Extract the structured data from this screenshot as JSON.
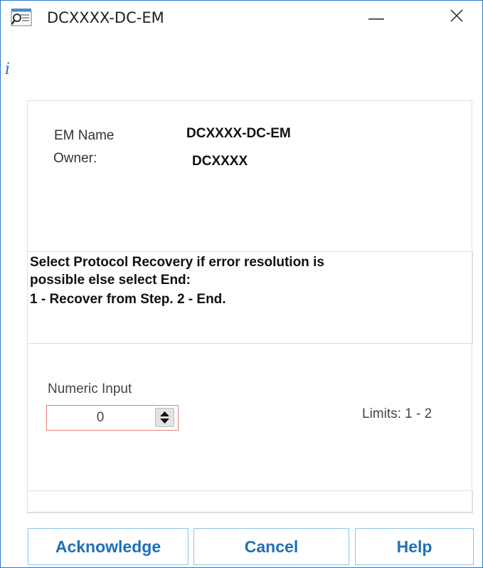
{
  "window": {
    "title": "DCXXXX-DC-EM",
    "icons": {
      "app": "document-search-icon",
      "minimize": "minimize-icon",
      "close": "close-icon",
      "info": "info-icon"
    },
    "info_glyph": "i"
  },
  "details": {
    "em_name_label": "EM Name",
    "em_name_value": "DCXXXX-DC-EM",
    "owner_label": "Owner:",
    "owner_value": "DCXXXX"
  },
  "message": {
    "lines": [
      "Select Protocol Recovery if error resolution is",
      "possible else select End:",
      "1 - Recover from Step. 2 - End."
    ]
  },
  "numeric_input": {
    "label": "Numeric Input",
    "value": "0",
    "limits": "Limits: 1 - 2"
  },
  "buttons": {
    "acknowledge": "Acknowledge",
    "cancel": "Cancel",
    "help": "Help"
  },
  "colors": {
    "window_border": "#2b78c5",
    "accent_text": "#1f6fb8",
    "button_border": "#8cc3ec",
    "input_error_border": "#e38080"
  }
}
